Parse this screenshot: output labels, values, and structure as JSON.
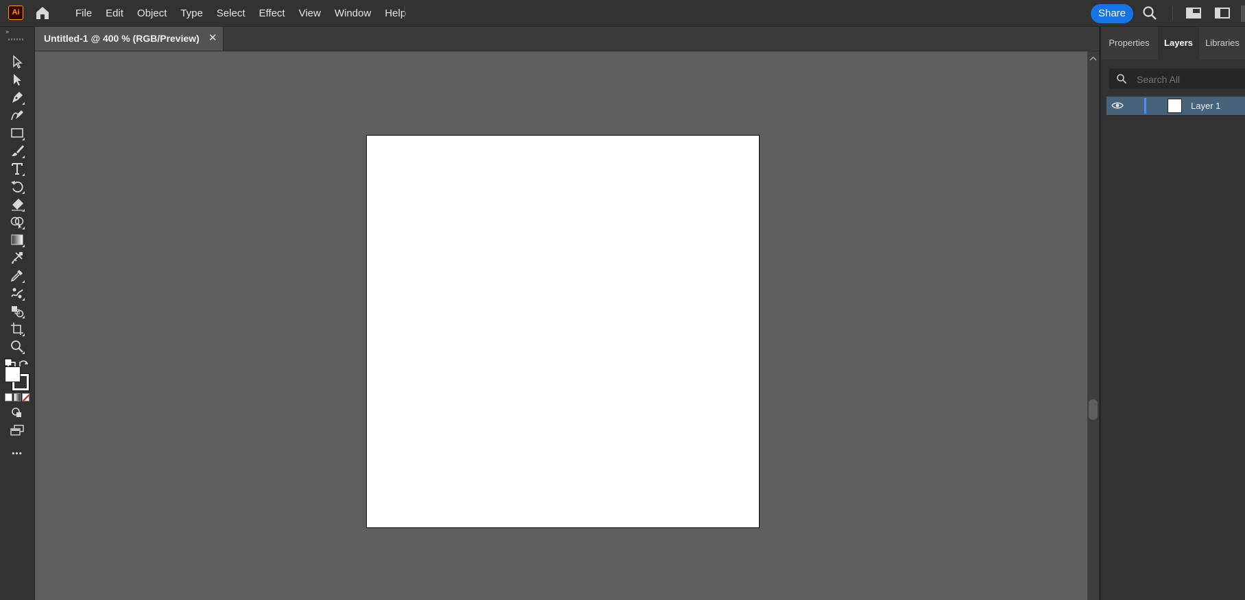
{
  "app": {
    "logo_text": "Ai",
    "menu": [
      "File",
      "Edit",
      "Object",
      "Type",
      "Select",
      "Effect",
      "View",
      "Window",
      "Help"
    ],
    "share_label": "Share"
  },
  "document": {
    "tab_title": "Untitled-1 @ 400 % (RGB/Preview)",
    "close_glyph": "✕"
  },
  "toolbar": {
    "collapse_glyph": "››",
    "tools": [
      "selection-tool",
      "direct-selection-tool",
      "pen-tool",
      "curvature-tool",
      "rectangle-tool",
      "paintbrush-tool",
      "type-tool",
      "rotate-tool",
      "eraser-tool",
      "shape-builder-tool",
      "gradient-tool",
      "mesh-tool",
      "eyedropper-tool",
      "puppet-warp-tool",
      "blend-tool",
      "artboard-tool",
      "zoom-tool"
    ],
    "more_glyph": "•••"
  },
  "right_panel": {
    "tabs": [
      "Properties",
      "Layers",
      "Libraries"
    ],
    "active_tab": "Layers",
    "search_placeholder": "Search All",
    "layers": [
      {
        "name": "Layer 1",
        "visible": true,
        "color": "#4f8cff"
      }
    ]
  },
  "colors": {
    "accent": "#1473e6",
    "layer_selected": "#46637c",
    "fill": "#ffffff",
    "stroke": "#000000"
  }
}
